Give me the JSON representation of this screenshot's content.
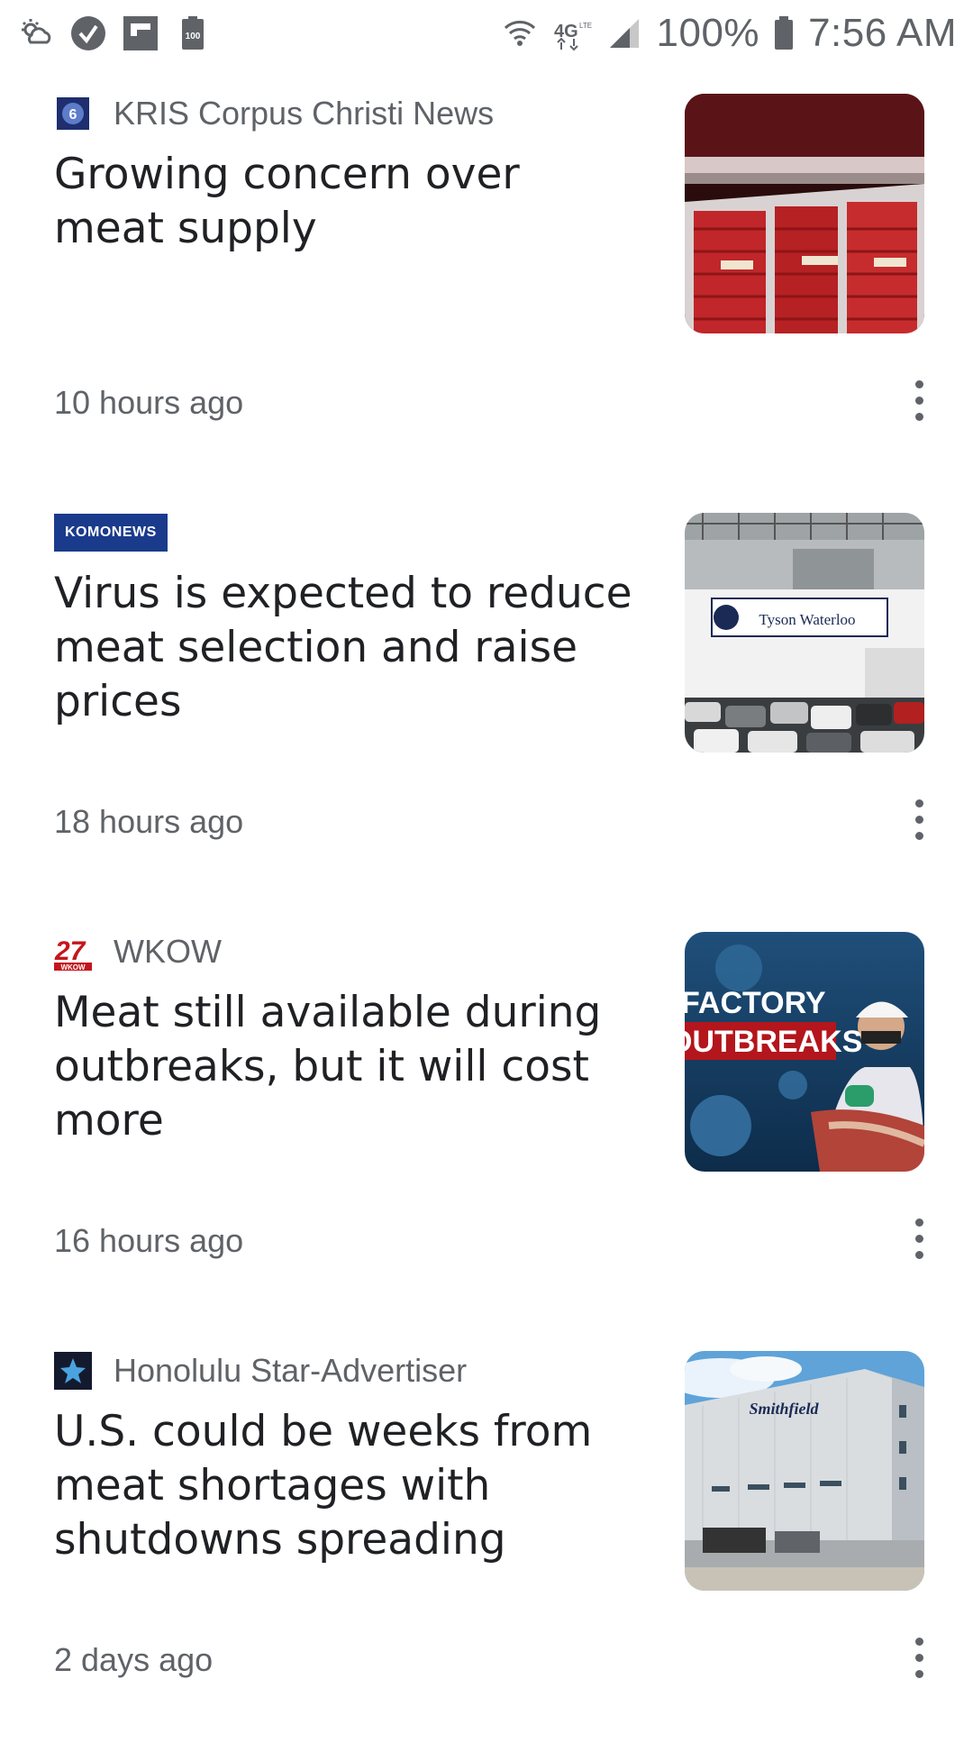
{
  "status_bar": {
    "network": "4G LTE",
    "battery_icon_text": "100",
    "battery_percent": "100%",
    "time": "7:56 AM"
  },
  "articles": [
    {
      "source": "KRIS Corpus Christi News",
      "headline": "Growing concern over meat supply",
      "time": "10 hours ago",
      "thumbnail": "meat-display-case"
    },
    {
      "source": "KOMONEWS",
      "headline": "Virus is expected to reduce meat selection and raise prices",
      "time": "18 hours ago",
      "thumbnail": "tyson-plant-parking",
      "thumb_sign": "Tyson Waterloo"
    },
    {
      "source": "WKOW",
      "logo_text": "27",
      "logo_subtext": "WKOW",
      "headline": "Meat still available during outbreaks, but it will cost more",
      "time": "16 hours ago",
      "thumbnail": "factory-outbreaks",
      "thumb_line1": "FACTORY",
      "thumb_line2": "OUTBREAKS"
    },
    {
      "source": "Honolulu Star-Advertiser",
      "headline": "U.S. could be weeks from meat shortages with shutdowns spreading",
      "time": "2 days ago",
      "thumbnail": "smithfield-plant",
      "thumb_sign": "Smithfield"
    }
  ]
}
